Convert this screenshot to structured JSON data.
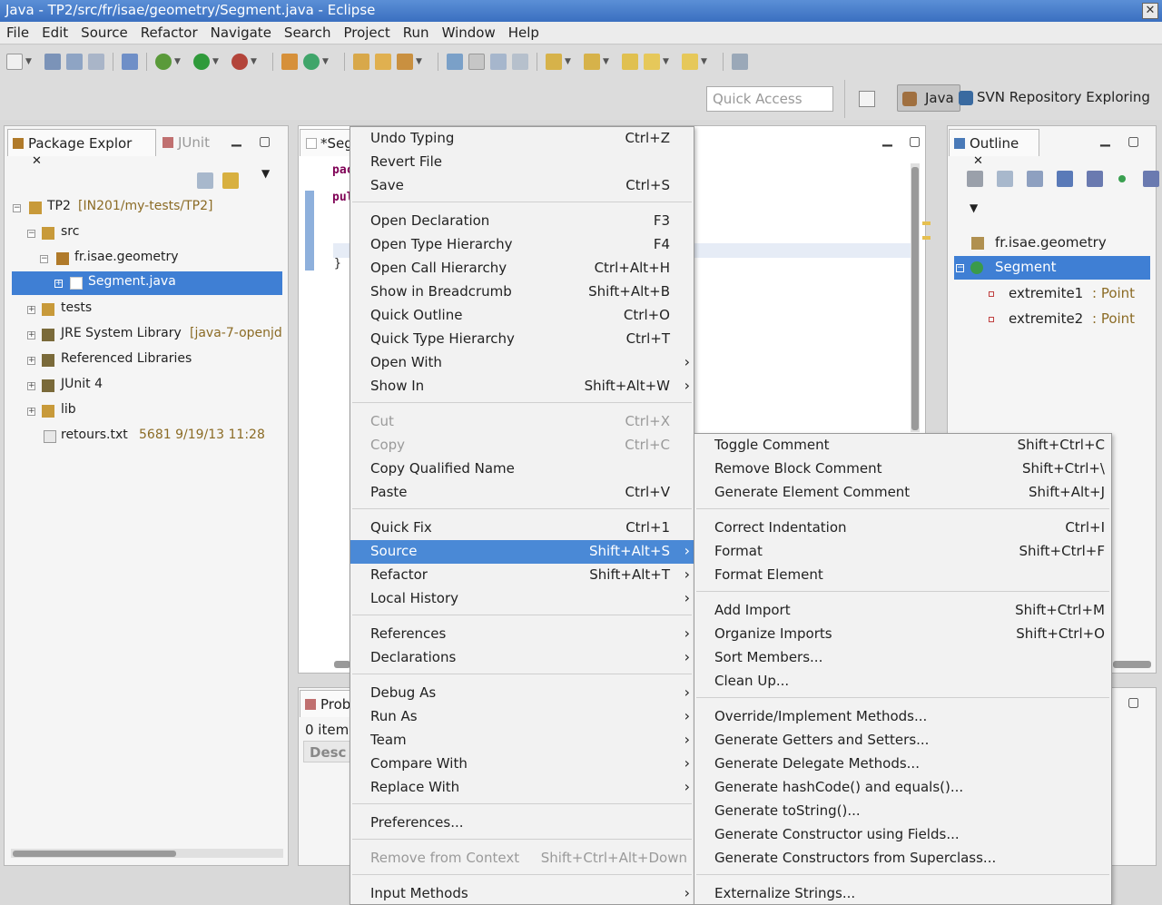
{
  "window": {
    "title": "Java - TP2/src/fr/isae/geometry/Segment.java - Eclipse",
    "close_glyph": "✕"
  },
  "menubar": [
    "File",
    "Edit",
    "Source",
    "Refactor",
    "Navigate",
    "Search",
    "Project",
    "Run",
    "Window",
    "Help"
  ],
  "toolbar": {
    "quick_access_placeholder": "Quick Access"
  },
  "perspectives": {
    "java": "Java",
    "svn": "SVN Repository Exploring"
  },
  "package_explorer": {
    "tab": "Package Explor",
    "tab2": "JUnit",
    "close_glyph": "✕",
    "tree": [
      {
        "label": "TP2",
        "dec": "[IN201/my-tests/TP2]",
        "expander": "−",
        "icon_color": "#c89a3a"
      },
      {
        "label": "src",
        "dec": "",
        "expander": "−",
        "icon_color": "#c89a3a"
      },
      {
        "label": "fr.isae.geometry",
        "dec": "",
        "expander": "−",
        "icon_color": "#b07a2a"
      },
      {
        "label": "Segment.java",
        "dec": "",
        "expander": "+",
        "icon_color": "#ffffff"
      },
      {
        "label": "tests",
        "dec": "",
        "expander": "+",
        "icon_color": "#c89a3a"
      },
      {
        "label": "JRE System Library",
        "dec": "[java-7-openjd",
        "expander": "+",
        "icon_color": "#7a6a3a"
      },
      {
        "label": "Referenced Libraries",
        "dec": "",
        "expander": "+",
        "icon_color": "#7a6a3a"
      },
      {
        "label": "JUnit 4",
        "dec": "",
        "expander": "+",
        "icon_color": "#7a6a3a"
      },
      {
        "label": "lib",
        "dec": "",
        "expander": "+",
        "icon_color": "#c89a3a"
      },
      {
        "label": "retours.txt",
        "dec": "5681  9/19/13 11:28",
        "expander": "",
        "icon_color": "#e8e8e8"
      }
    ]
  },
  "editor": {
    "tab": "*Seg",
    "code_lines": [
      "pac",
      "pul",
      "}"
    ]
  },
  "problems": {
    "tab": "Prob",
    "count": "0 items",
    "col": "Desc"
  },
  "outline": {
    "tab": "Outline",
    "close_glyph": "✕",
    "items": [
      {
        "label": "fr.isae.geometry",
        "type": ""
      },
      {
        "label": "Segment",
        "type": ""
      },
      {
        "label": "extremite1",
        "type": ": Point"
      },
      {
        "label": "extremite2",
        "type": ": Point"
      }
    ]
  },
  "context_menu": {
    "items": [
      {
        "label": "Undo Typing",
        "shortcut": "Ctrl+Z"
      },
      {
        "label": "Revert File",
        "shortcut": ""
      },
      {
        "label": "Save",
        "shortcut": "Ctrl+S"
      },
      {
        "label": "Open Declaration",
        "shortcut": "F3"
      },
      {
        "label": "Open Type Hierarchy",
        "shortcut": "F4"
      },
      {
        "label": "Open Call Hierarchy",
        "shortcut": "Ctrl+Alt+H"
      },
      {
        "label": "Show in Breadcrumb",
        "shortcut": "Shift+Alt+B"
      },
      {
        "label": "Quick Outline",
        "shortcut": "Ctrl+O"
      },
      {
        "label": "Quick Type Hierarchy",
        "shortcut": "Ctrl+T"
      },
      {
        "label": "Open With",
        "shortcut": "",
        "submenu": true
      },
      {
        "label": "Show In",
        "shortcut": "Shift+Alt+W",
        "submenu": true
      },
      {
        "label": "Cut",
        "shortcut": "Ctrl+X",
        "disabled": true
      },
      {
        "label": "Copy",
        "shortcut": "Ctrl+C",
        "disabled": true
      },
      {
        "label": "Copy Qualified Name",
        "shortcut": ""
      },
      {
        "label": "Paste",
        "shortcut": "Ctrl+V"
      },
      {
        "label": "Quick Fix",
        "shortcut": "Ctrl+1"
      },
      {
        "label": "Source",
        "shortcut": "Shift+Alt+S",
        "submenu": true,
        "highlighted": true
      },
      {
        "label": "Refactor",
        "shortcut": "Shift+Alt+T",
        "submenu": true
      },
      {
        "label": "Local History",
        "shortcut": "",
        "submenu": true
      },
      {
        "label": "References",
        "shortcut": "",
        "submenu": true
      },
      {
        "label": "Declarations",
        "shortcut": "",
        "submenu": true
      },
      {
        "label": "Debug As",
        "shortcut": "",
        "submenu": true
      },
      {
        "label": "Run As",
        "shortcut": "",
        "submenu": true
      },
      {
        "label": "Team",
        "shortcut": "",
        "submenu": true
      },
      {
        "label": "Compare With",
        "shortcut": "",
        "submenu": true
      },
      {
        "label": "Replace With",
        "shortcut": "",
        "submenu": true
      },
      {
        "label": "Preferences...",
        "shortcut": ""
      },
      {
        "label": "Remove from Context",
        "shortcut": "Shift+Ctrl+Alt+Down",
        "disabled": true
      },
      {
        "label": "Input Methods",
        "shortcut": "",
        "submenu": true
      }
    ],
    "submenu_arrow": "›"
  },
  "source_submenu": {
    "items": [
      {
        "label": "Toggle Comment",
        "shortcut": "Shift+Ctrl+C"
      },
      {
        "label": "Remove Block Comment",
        "shortcut": "Shift+Ctrl+\\"
      },
      {
        "label": "Generate Element Comment",
        "shortcut": "Shift+Alt+J"
      },
      {
        "label": "Correct Indentation",
        "shortcut": "Ctrl+I"
      },
      {
        "label": "Format",
        "shortcut": "Shift+Ctrl+F"
      },
      {
        "label": "Format Element",
        "shortcut": ""
      },
      {
        "label": "Add Import",
        "shortcut": "Shift+Ctrl+M"
      },
      {
        "label": "Organize Imports",
        "shortcut": "Shift+Ctrl+O"
      },
      {
        "label": "Sort Members...",
        "shortcut": ""
      },
      {
        "label": "Clean Up...",
        "shortcut": ""
      },
      {
        "label": "Override/Implement Methods...",
        "shortcut": ""
      },
      {
        "label": "Generate Getters and Setters...",
        "shortcut": ""
      },
      {
        "label": "Generate Delegate Methods...",
        "shortcut": ""
      },
      {
        "label": "Generate hashCode() and equals()...",
        "shortcut": ""
      },
      {
        "label": "Generate toString()...",
        "shortcut": ""
      },
      {
        "label": "Generate Constructor using Fields...",
        "shortcut": ""
      },
      {
        "label": "Generate Constructors from Superclass...",
        "shortcut": ""
      },
      {
        "label": "Externalize Strings...",
        "shortcut": ""
      }
    ]
  },
  "colors": {
    "selection": "#3f7fd4",
    "menu_highlight": "#4a89d6",
    "decorator": "#8b6b25"
  }
}
